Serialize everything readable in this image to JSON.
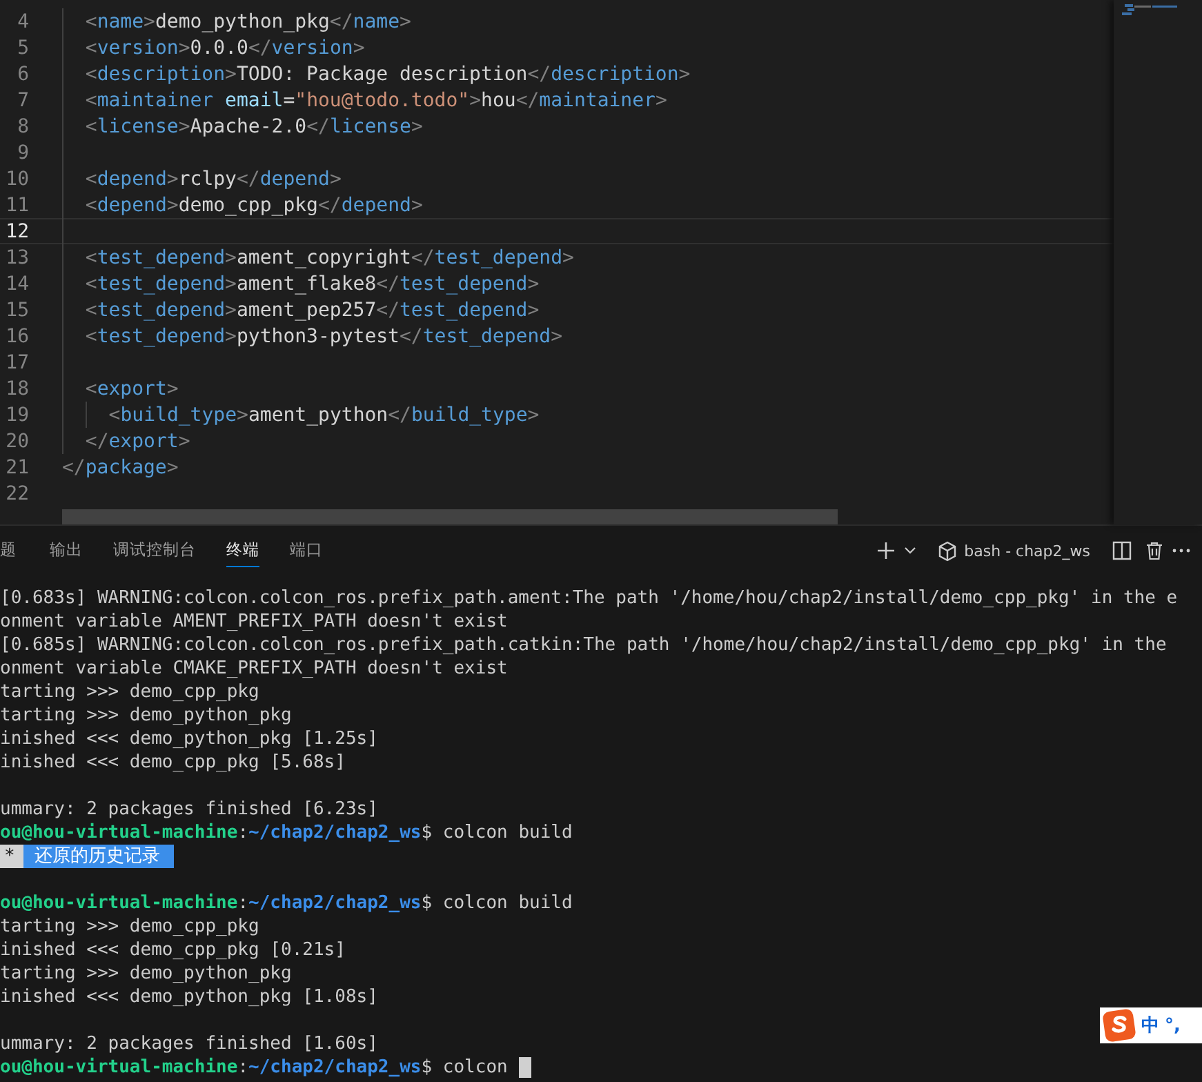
{
  "editor": {
    "lines": [
      {
        "number": "4",
        "current": false,
        "kind": "inner",
        "segs": [
          {
            "kind": "punct",
            "text": "<"
          },
          {
            "kind": "tag",
            "text": "name"
          },
          {
            "kind": "punct",
            "text": ">"
          },
          {
            "kind": "text",
            "text": "demo_python_pkg"
          },
          {
            "kind": "punct",
            "text": "</"
          },
          {
            "kind": "tag",
            "text": "name"
          },
          {
            "kind": "punct",
            "text": ">"
          }
        ]
      },
      {
        "number": "5",
        "current": false,
        "kind": "inner",
        "segs": [
          {
            "kind": "punct",
            "text": "<"
          },
          {
            "kind": "tag",
            "text": "version"
          },
          {
            "kind": "punct",
            "text": ">"
          },
          {
            "kind": "text",
            "text": "0.0.0"
          },
          {
            "kind": "punct",
            "text": "</"
          },
          {
            "kind": "tag",
            "text": "version"
          },
          {
            "kind": "punct",
            "text": ">"
          }
        ]
      },
      {
        "number": "6",
        "current": false,
        "kind": "inner",
        "segs": [
          {
            "kind": "punct",
            "text": "<"
          },
          {
            "kind": "tag",
            "text": "description"
          },
          {
            "kind": "punct",
            "text": ">"
          },
          {
            "kind": "text",
            "text": "TODO: Package description"
          },
          {
            "kind": "punct",
            "text": "</"
          },
          {
            "kind": "tag",
            "text": "description"
          },
          {
            "kind": "punct",
            "text": ">"
          }
        ]
      },
      {
        "number": "7",
        "current": false,
        "kind": "inner",
        "segs": [
          {
            "kind": "punct",
            "text": "<"
          },
          {
            "kind": "tag",
            "text": "maintainer"
          },
          {
            "kind": "attr",
            "text": "email"
          },
          {
            "kind": "text",
            "text": "="
          },
          {
            "kind": "string",
            "text": "\"hou@todo.todo\""
          },
          {
            "kind": "punct",
            "text": ">"
          },
          {
            "kind": "text",
            "text": "hou"
          },
          {
            "kind": "punct",
            "text": "</"
          },
          {
            "kind": "tag",
            "text": "maintainer"
          },
          {
            "kind": "punct",
            "text": ">"
          }
        ]
      },
      {
        "number": "8",
        "current": false,
        "kind": "inner",
        "segs": [
          {
            "kind": "punct",
            "text": "<"
          },
          {
            "kind": "tag",
            "text": "license"
          },
          {
            "kind": "punct",
            "text": ">"
          },
          {
            "kind": "text",
            "text": "Apache-2.0"
          },
          {
            "kind": "punct",
            "text": "</"
          },
          {
            "kind": "tag",
            "text": "license"
          },
          {
            "kind": "punct",
            "text": ">"
          }
        ]
      },
      {
        "number": "9",
        "current": false
      },
      {
        "number": "10",
        "current": false,
        "kind": "inner",
        "segs": [
          {
            "kind": "punct",
            "text": "<"
          },
          {
            "kind": "tag",
            "text": "depend"
          },
          {
            "kind": "punct",
            "text": ">"
          },
          {
            "kind": "text",
            "text": "rclpy"
          },
          {
            "kind": "punct",
            "text": "</"
          },
          {
            "kind": "tag",
            "text": "depend"
          },
          {
            "kind": "punct",
            "text": ">"
          }
        ]
      },
      {
        "number": "11",
        "current": false,
        "kind": "inner",
        "segs": [
          {
            "kind": "punct",
            "text": "<"
          },
          {
            "kind": "tag",
            "text": "depend"
          },
          {
            "kind": "punct",
            "text": ">"
          },
          {
            "kind": "text",
            "text": "demo_cpp_pkg"
          },
          {
            "kind": "punct",
            "text": "</"
          },
          {
            "kind": "tag",
            "text": "depend"
          },
          {
            "kind": "punct",
            "text": ">"
          }
        ]
      },
      {
        "number": "12",
        "current": true
      },
      {
        "number": "13",
        "current": false,
        "kind": "inner",
        "segs": [
          {
            "kind": "punct",
            "text": "<"
          },
          {
            "kind": "tag",
            "text": "test_depend"
          },
          {
            "kind": "punct",
            "text": ">"
          },
          {
            "kind": "text",
            "text": "ament_copyright"
          },
          {
            "kind": "punct",
            "text": "</"
          },
          {
            "kind": "tag",
            "text": "test_depend"
          },
          {
            "kind": "punct",
            "text": ">"
          }
        ]
      },
      {
        "number": "14",
        "current": false,
        "kind": "inner",
        "segs": [
          {
            "kind": "punct",
            "text": "<"
          },
          {
            "kind": "tag",
            "text": "test_depend"
          },
          {
            "kind": "punct",
            "text": ">"
          },
          {
            "kind": "text",
            "text": "ament_flake8"
          },
          {
            "kind": "punct",
            "text": "</"
          },
          {
            "kind": "tag",
            "text": "test_depend"
          },
          {
            "kind": "punct",
            "text": ">"
          }
        ]
      },
      {
        "number": "15",
        "current": false,
        "kind": "inner",
        "segs": [
          {
            "kind": "punct",
            "text": "<"
          },
          {
            "kind": "tag",
            "text": "test_depend"
          },
          {
            "kind": "punct",
            "text": ">"
          },
          {
            "kind": "text",
            "text": "ament_pep257"
          },
          {
            "kind": "punct",
            "text": "</"
          },
          {
            "kind": "tag",
            "text": "test_depend"
          },
          {
            "kind": "punct",
            "text": ">"
          }
        ]
      },
      {
        "number": "16",
        "current": false,
        "kind": "inner",
        "segs": [
          {
            "kind": "punct",
            "text": "<"
          },
          {
            "kind": "tag",
            "text": "test_depend"
          },
          {
            "kind": "punct",
            "text": ">"
          },
          {
            "kind": "text",
            "text": "python3-pytest"
          },
          {
            "kind": "punct",
            "text": "</"
          },
          {
            "kind": "tag",
            "text": "test_depend"
          },
          {
            "kind": "punct",
            "text": ">"
          }
        ]
      },
      {
        "number": "17",
        "current": false
      },
      {
        "number": "18",
        "current": false,
        "kind": "inner",
        "segs": [
          {
            "kind": "punct",
            "text": "<"
          },
          {
            "kind": "tag",
            "text": "export"
          },
          {
            "kind": "punct",
            "text": ">"
          }
        ]
      },
      {
        "number": "19",
        "current": false,
        "kind": "nested",
        "segs": [
          {
            "kind": "punct",
            "text": "<"
          },
          {
            "kind": "tag",
            "text": "build_type"
          },
          {
            "kind": "punct",
            "text": ">"
          },
          {
            "kind": "text",
            "text": "ament_python"
          },
          {
            "kind": "punct",
            "text": "</"
          },
          {
            "kind": "tag",
            "text": "build_type"
          },
          {
            "kind": "punct",
            "text": ">"
          }
        ]
      },
      {
        "number": "20",
        "current": false,
        "kind": "inner",
        "segs": [
          {
            "kind": "punct",
            "text": "</"
          },
          {
            "kind": "tag",
            "text": "export"
          },
          {
            "kind": "punct",
            "text": ">"
          }
        ]
      },
      {
        "number": "21",
        "current": false,
        "kind": "root",
        "segs": [
          {
            "kind": "punct",
            "text": "</"
          },
          {
            "kind": "tag",
            "text": "package"
          },
          {
            "kind": "punct",
            "text": ">"
          }
        ]
      },
      {
        "number": "22",
        "current": false
      }
    ]
  },
  "panel": {
    "tabs": [
      {
        "label": "题",
        "selected": false
      },
      {
        "label": "输出",
        "selected": false
      },
      {
        "label": "调试控制台",
        "selected": false
      },
      {
        "label": "终端",
        "selected": true
      },
      {
        "label": "端口",
        "selected": false
      }
    ],
    "terminal_name": "bash - chap2_ws"
  },
  "terminal": {
    "lines": [
      {
        "kind": "plain",
        "text": "[0.683s] WARNING:colcon.colcon_ros.prefix_path.ament:The path '/home/hou/chap2/install/demo_cpp_pkg' in the e"
      },
      {
        "kind": "plain",
        "text": "onment variable AMENT_PREFIX_PATH doesn't exist"
      },
      {
        "kind": "plain",
        "text": "[0.685s] WARNING:colcon.colcon_ros.prefix_path.catkin:The path '/home/hou/chap2/install/demo_cpp_pkg' in the"
      },
      {
        "kind": "plain",
        "text": "onment variable CMAKE_PREFIX_PATH doesn't exist"
      },
      {
        "kind": "plain",
        "text": "tarting >>> demo_cpp_pkg"
      },
      {
        "kind": "plain",
        "text": "tarting >>> demo_python_pkg"
      },
      {
        "kind": "plain",
        "text": "inished <<< demo_python_pkg [1.25s]"
      },
      {
        "kind": "plain",
        "text": "inished <<< demo_cpp_pkg [5.68s]"
      },
      {
        "kind": "blank"
      },
      {
        "kind": "plain",
        "text": "ummary: 2 packages finished [6.23s]"
      },
      {
        "kind": "prompt",
        "user": "ou@hou-virtual-machine",
        "separator": ":",
        "path": "~/chap2/chap2_ws",
        "command": "$ colcon build"
      },
      {
        "kind": "highlight",
        "marker": "*",
        "text": "还原的历史记录"
      },
      {
        "kind": "blank"
      },
      {
        "kind": "prompt",
        "user": "ou@hou-virtual-machine",
        "separator": ":",
        "path": "~/chap2/chap2_ws",
        "command": "$ colcon build"
      },
      {
        "kind": "plain",
        "text": "tarting >>> demo_cpp_pkg"
      },
      {
        "kind": "plain",
        "text": "inished <<< demo_cpp_pkg [0.21s]"
      },
      {
        "kind": "plain",
        "text": "tarting >>> demo_python_pkg"
      },
      {
        "kind": "plain",
        "text": "inished <<< demo_python_pkg [1.08s]"
      },
      {
        "kind": "blank"
      },
      {
        "kind": "plain",
        "text": "ummary: 2 packages finished [1.60s]"
      },
      {
        "kind": "prompt",
        "user": "ou@hou-virtual-machine",
        "separator": ":",
        "path": "~/chap2/chap2_ws",
        "command": "$ colcon",
        "cursor": true
      }
    ]
  },
  "ime": {
    "mode": "中",
    "punct": "°,"
  }
}
